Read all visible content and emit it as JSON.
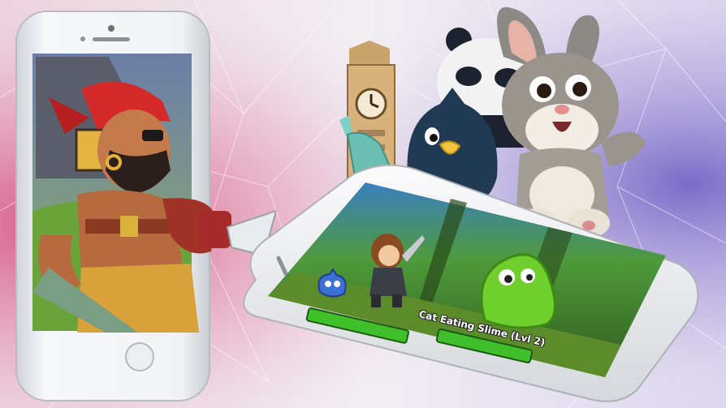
{
  "scene": {
    "colors": {
      "left_glow": "#d24a78",
      "right_glow": "#6f5fc4",
      "phone_body": "#eef0f3",
      "phone_bezel": "#dcdfe3",
      "slime": "#6fcf2d",
      "hp_bar": "#3fbf2a"
    }
  },
  "game_screen": {
    "enemy_label": "Cat Eating Slime (Lvl 2)"
  },
  "characters": {
    "icons": [
      "pirate-icon",
      "big-ben-icon",
      "liberty-statue-icon",
      "panda-icon",
      "penguin-icon",
      "rabbit-icon",
      "knight-icon",
      "slime-icon",
      "blue-bird-icon"
    ]
  }
}
